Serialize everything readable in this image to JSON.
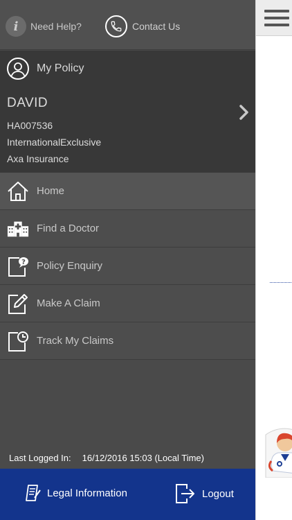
{
  "header": {
    "need_help": "Need Help?",
    "contact_us": "Contact Us"
  },
  "policy": {
    "title": "My Policy",
    "name": "DAVID",
    "policy_number": "HA007536",
    "plan": "InternationalExclusive",
    "insurer": "Axa Insurance"
  },
  "menu": {
    "items": [
      {
        "label": "Home",
        "icon": "home-icon"
      },
      {
        "label": "Find a Doctor",
        "icon": "hospital-icon"
      },
      {
        "label": "Policy Enquiry",
        "icon": "enquiry-icon"
      },
      {
        "label": "Make A Claim",
        "icon": "edit-icon"
      },
      {
        "label": "Track My Claims",
        "icon": "clock-document-icon"
      }
    ]
  },
  "footer": {
    "last_logged_label": "Last Logged In:",
    "last_logged_value": "16/12/2016 15:03 (Local Time)",
    "legal": "Legal Information",
    "logout": "Logout"
  },
  "colors": {
    "drawer_bg": "#4a4a4a",
    "policy_bg": "#383838",
    "footer_bg": "#13348c"
  }
}
